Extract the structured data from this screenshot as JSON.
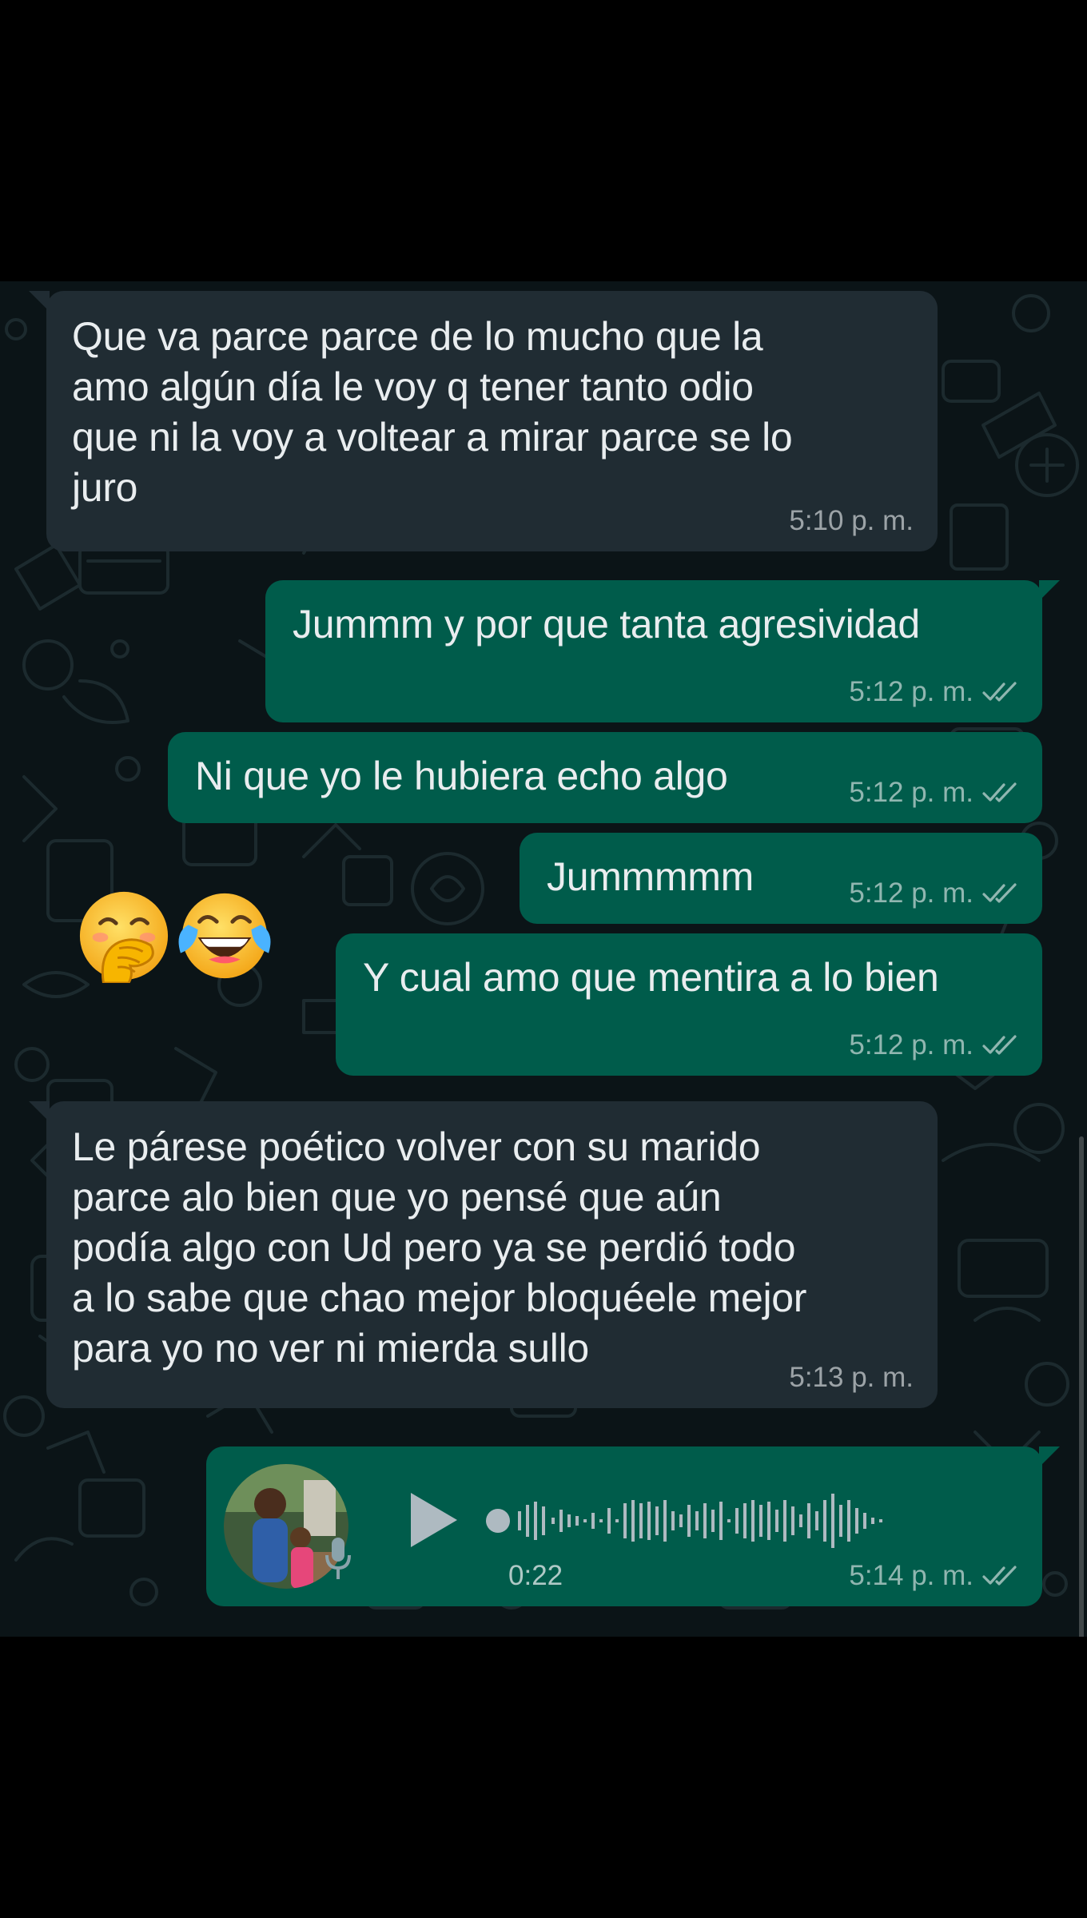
{
  "messages": [
    {
      "text": "Que va parce parce de lo mucho que la\namo algún día le voy q tener tanto odio\nque ni la voy a voltear a mirar parce se lo\njuro",
      "time": "5:10 p. m."
    },
    {
      "text": "Jummm y por que tanta agresividad",
      "time": "5:12 p. m."
    },
    {
      "text": "Ni que yo le hubiera echo algo",
      "time": "5:12 p. m."
    },
    {
      "text": "Jummmmm",
      "time": "5:12 p. m."
    },
    {
      "text": "Y cual amo que mentira a lo bien",
      "time": "5:12 p. m."
    },
    {
      "text": "Le párese poético volver con su marido\nparce alo bien que yo pensé que aún\npodía algo con Ud pero ya se perdió todo\na lo sabe que chao mejor bloquéele mejor\npara yo no ver ni mierda sullo",
      "time": "5:13 p. m."
    }
  ],
  "voice_note": {
    "duration": "0:22",
    "time": "5:14 p. m.",
    "progress": 0
  },
  "reactions": {
    "first_icon": "face-with-hand-over-mouth-icon",
    "second_icon": "tears-of-joy-icon"
  },
  "colors": {
    "incoming": "#202c33",
    "outgoing": "#005c4b",
    "background": "#0b1417",
    "text": "#e9edef"
  }
}
